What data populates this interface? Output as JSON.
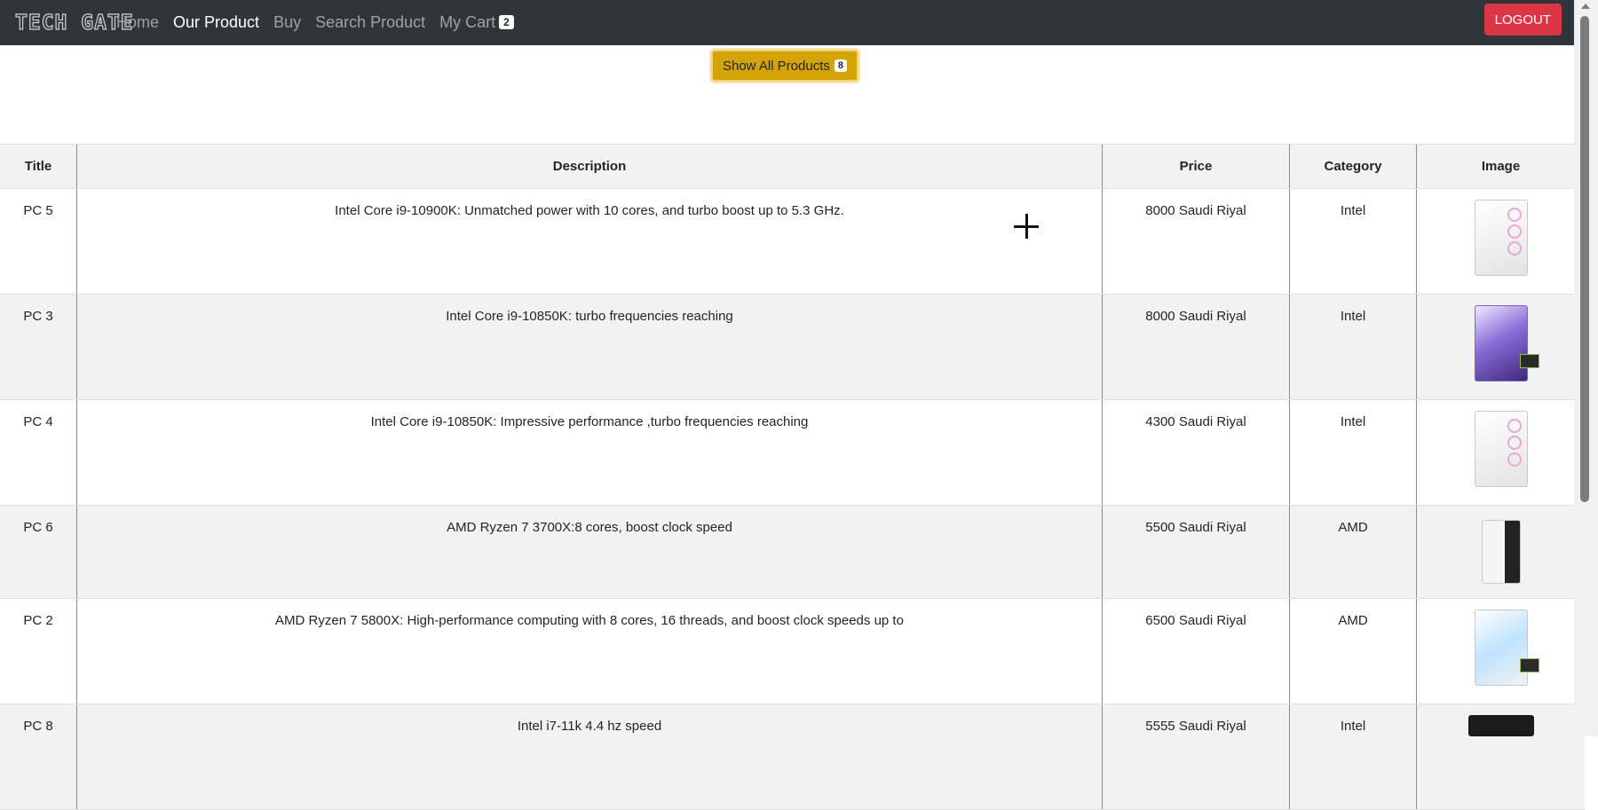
{
  "navbar": {
    "logo": "TECH GATE",
    "links": [
      "Home",
      "Our Product",
      "Buy",
      "Search Product",
      "My Cart"
    ],
    "cart_count": "2",
    "logout_label": "LOGOUT"
  },
  "show_all": {
    "label": "Show All Products",
    "count": "8"
  },
  "table": {
    "headers": [
      "Title",
      "Description",
      "Price",
      "Category",
      "Image"
    ],
    "rows": [
      {
        "title": "PC 5",
        "description": "Intel Core i9-10900K: Unmatched power with 10 cores, and turbo boost up to 5.3 GHz.",
        "price": "8000 Saudi Riyal",
        "category": "Intel",
        "image": "white-pc-case-rgb-fans"
      },
      {
        "title": "PC 3",
        "description": "Intel Core i9-10850K: turbo frequencies reaching",
        "price": "8000 Saudi Riyal",
        "category": "Intel",
        "image": "purple-pc-case"
      },
      {
        "title": "PC 4",
        "description": "Intel Core i9-10850K: Impressive performance ,turbo frequencies reaching",
        "price": "4300 Saudi Riyal",
        "category": "Intel",
        "image": "white-pc-case-rgb-fans"
      },
      {
        "title": "PC 6",
        "description": "AMD Ryzen 7 3700X:8 cores, boost clock speed",
        "price": "5500 Saudi Riyal",
        "category": "AMD",
        "image": "white-black-tower-case"
      },
      {
        "title": "PC 2",
        "description": "AMD Ryzen 7 5800X: High-performance computing with 8 cores, 16 threads, and boost clock speeds up to",
        "price": "6500 Saudi Riyal",
        "category": "AMD",
        "image": "white-blue-pc-case"
      },
      {
        "title": "PC 8",
        "description": "Intel i7-11k 4.4 hz speed",
        "price": "5555 Saudi Riyal",
        "category": "Intel",
        "image": "dark-pc-case"
      }
    ]
  }
}
